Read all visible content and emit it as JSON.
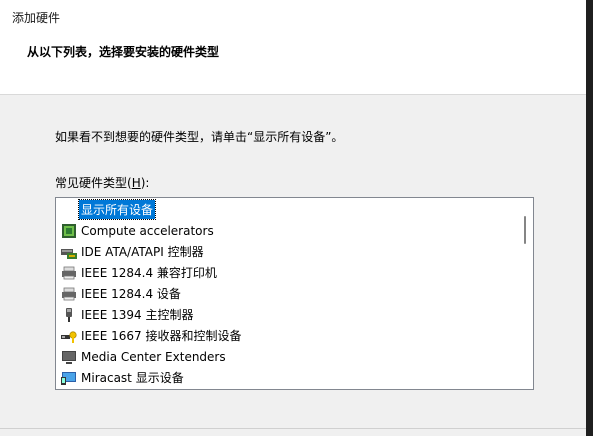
{
  "window": {
    "title": "添加硬件",
    "header": "从以下列表，选择要安装的硬件类型"
  },
  "content": {
    "hint": "如果看不到想要的硬件类型，请单击“显示所有设备”。",
    "list_label_prefix": "常见硬件类型(",
    "list_label_accel": "H",
    "list_label_suffix": "):"
  },
  "list": {
    "items": [
      {
        "label": "显示所有设备",
        "icon": "none",
        "selected": true
      },
      {
        "label": "Compute accelerators",
        "icon": "chip-icon"
      },
      {
        "label": "IDE ATA/ATAPI 控制器",
        "icon": "ide-controller-icon"
      },
      {
        "label": "IEEE 1284.4 兼容打印机",
        "icon": "printer-icon"
      },
      {
        "label": "IEEE 1284.4 设备",
        "icon": "printer-icon"
      },
      {
        "label": "IEEE 1394 主控制器",
        "icon": "firewire-icon"
      },
      {
        "label": "IEEE 1667 接收器和控制设备",
        "icon": "usb-key-icon"
      },
      {
        "label": "Media Center Extenders",
        "icon": "monitor-icon"
      },
      {
        "label": "Miracast 显示设备",
        "icon": "miracast-icon"
      }
    ]
  },
  "colors": {
    "selection": "#0078d7",
    "window_bg": "#f0f0f0",
    "header_bg": "#ffffff"
  }
}
